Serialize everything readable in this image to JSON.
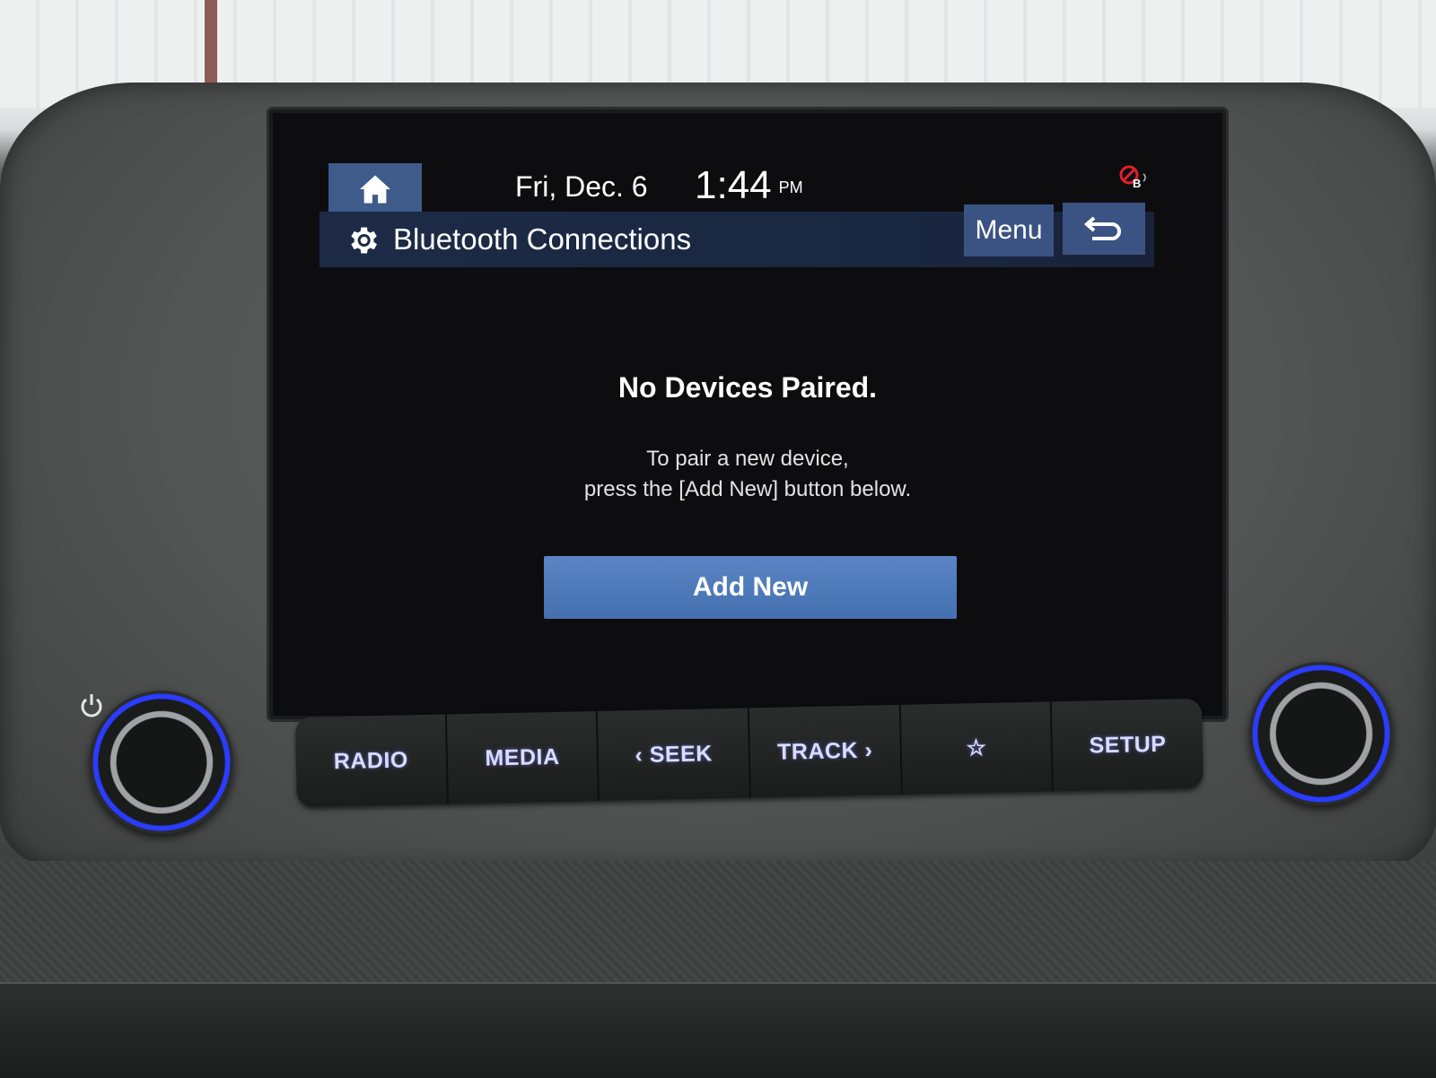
{
  "status_bar": {
    "date": "Fri, Dec. 6",
    "time": "1:44",
    "ampm": "PM",
    "bluetooth_status_icon": "bluetooth-disconnected-icon"
  },
  "header": {
    "title": "Bluetooth Connections",
    "title_icon": "gear-icon",
    "menu_label": "Menu",
    "home_icon": "home-icon",
    "back_icon": "back-arrow-icon"
  },
  "content": {
    "heading": "No Devices Paired.",
    "instruction_line1": "To pair a new device,",
    "instruction_line2": "press the [Add New] button below.",
    "add_button_label": "Add New"
  },
  "hardware_buttons": [
    {
      "label": "RADIO"
    },
    {
      "label": "MEDIA"
    },
    {
      "label": "‹ SEEK"
    },
    {
      "label": "TRACK ›"
    },
    {
      "label": "☆"
    },
    {
      "label": "SETUP"
    }
  ],
  "colors": {
    "accent_blue": "#3b5382",
    "add_button_blue": "#4f7bbd",
    "screen_bg": "#0d0d10",
    "knob_glow": "#2a3cff"
  }
}
